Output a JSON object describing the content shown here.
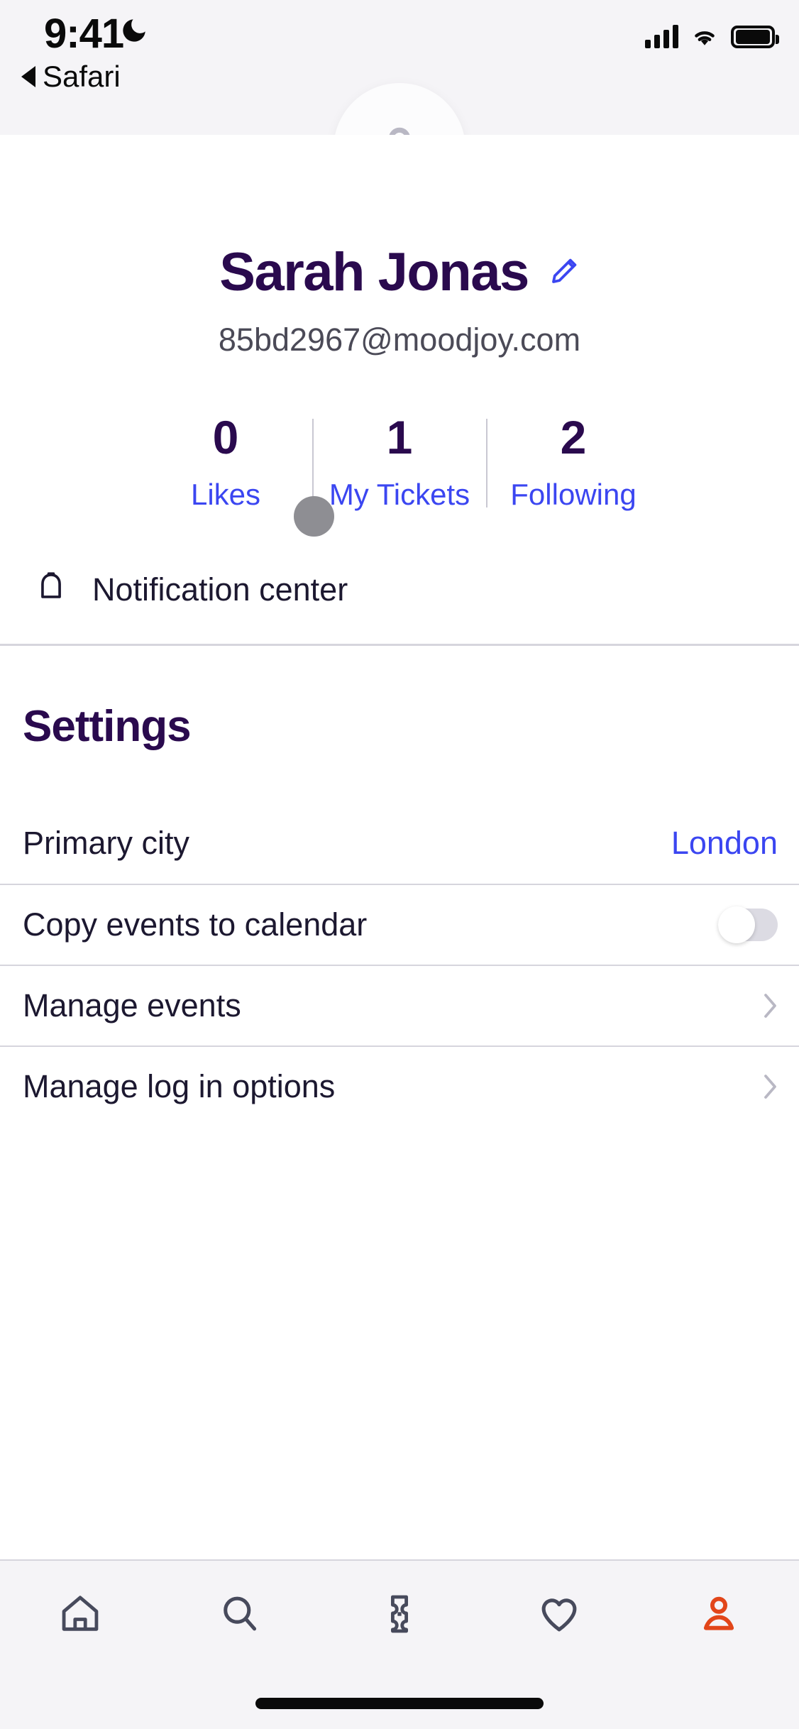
{
  "status_bar": {
    "time": "9:41",
    "dnd_icon": "moon-icon",
    "back_label": "Safari",
    "back_icon": "triangle-left-icon",
    "cellular_icon": "cellular-bars-icon",
    "wifi_icon": "wifi-icon",
    "battery_icon": "battery-full-icon"
  },
  "profile": {
    "avatar_icon": "person-icon",
    "name": "Sarah Jonas",
    "edit_icon": "pencil-icon",
    "email": "85bd2967@moodjoy.com",
    "stats": [
      {
        "value": "0",
        "label": "Likes"
      },
      {
        "value": "1",
        "label": "My Tickets"
      },
      {
        "value": "2",
        "label": "Following"
      }
    ],
    "notification": {
      "icon": "bell-icon",
      "label": "Notification center"
    }
  },
  "settings": {
    "title": "Settings",
    "rows": [
      {
        "label": "Primary city",
        "value": "London",
        "control": "value"
      },
      {
        "label": "Copy events to calendar",
        "value": "off",
        "control": "toggle"
      },
      {
        "label": "Manage events",
        "value": "",
        "control": "chevron"
      },
      {
        "label": "Manage log in options",
        "value": "",
        "control": "chevron"
      }
    ]
  },
  "tabbar": {
    "items": [
      {
        "icon": "home-icon",
        "active": false
      },
      {
        "icon": "search-icon",
        "active": false
      },
      {
        "icon": "ticket-icon",
        "active": false
      },
      {
        "icon": "heart-icon",
        "active": false
      },
      {
        "icon": "profile-icon",
        "active": true
      }
    ]
  },
  "colors": {
    "accent_blue": "#3b46f1",
    "heading_purple": "#2a0a4e",
    "active_tab": "#e2461a",
    "inactive_tab": "#474a5c",
    "divider": "#d6d5dd",
    "status_bg": "#f5f4f7"
  },
  "cursor": {
    "name": "pointer-dot"
  }
}
